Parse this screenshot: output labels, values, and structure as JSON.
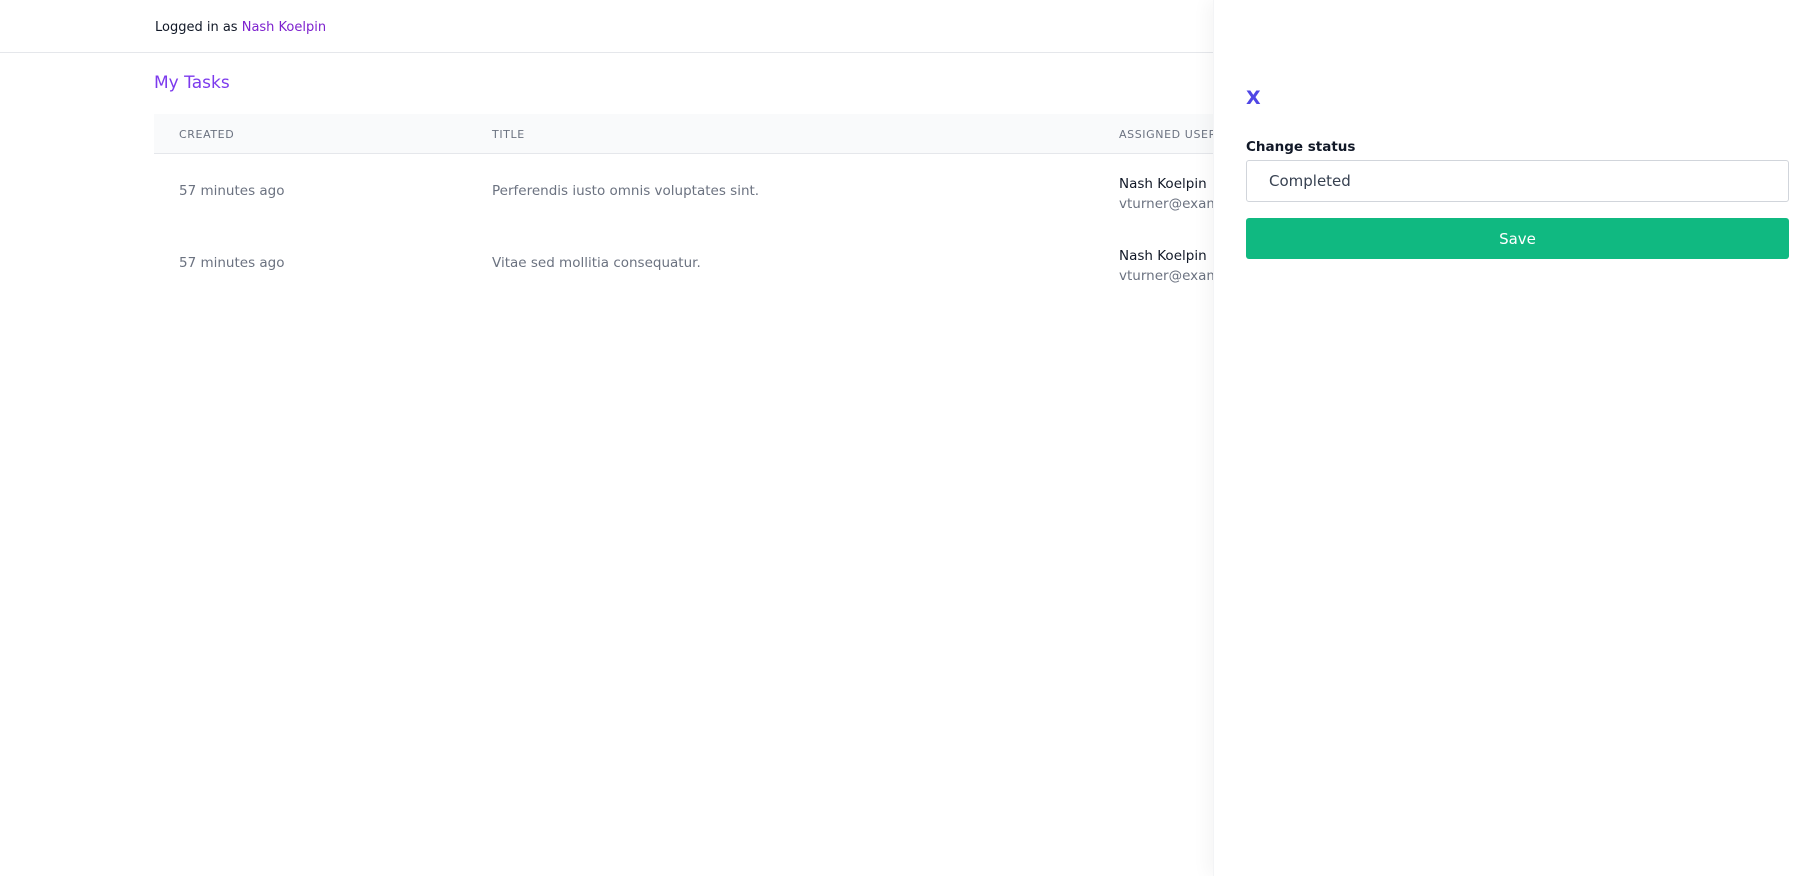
{
  "header": {
    "logged_in_prefix": "Logged in as",
    "user_name": "Nash Koelpin"
  },
  "page": {
    "title": "My Tasks"
  },
  "table": {
    "columns": [
      "CREATED",
      "TITLE",
      "ASSIGNED USER"
    ],
    "rows": [
      {
        "created": "57 minutes ago",
        "title": "Perferendis iusto omnis voluptates sint.",
        "user_name": "Nash Koelpin",
        "user_email": "vturner@examp"
      },
      {
        "created": "57 minutes ago",
        "title": "Vitae sed mollitia consequatur.",
        "user_name": "Nash Koelpin",
        "user_email": "vturner@examp"
      }
    ]
  },
  "panel": {
    "close_label": "X",
    "status_label": "Change status",
    "status_value": "Completed",
    "save_label": "Save"
  },
  "colors": {
    "accent": "#7c3aed",
    "save_button": "#10b981",
    "close_icon": "#4f46e5"
  }
}
